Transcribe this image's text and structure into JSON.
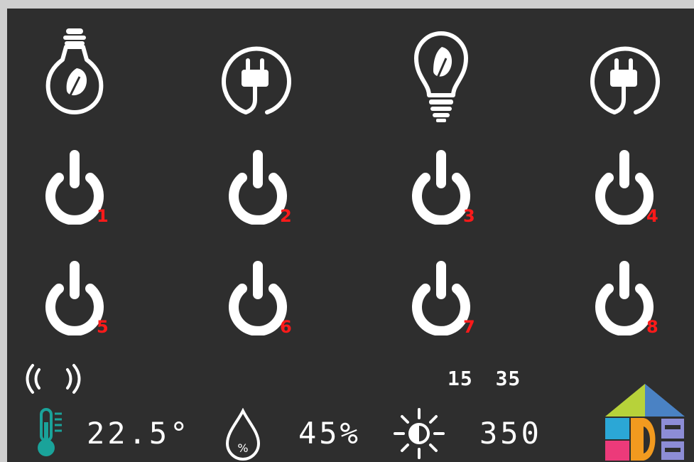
{
  "devices": [
    {
      "icon": "eco-bulb-icon"
    },
    {
      "icon": "plug-icon"
    },
    {
      "icon": "leaf-bulb-icon"
    },
    {
      "icon": "plug-icon"
    }
  ],
  "buttons": [
    {
      "label": "1"
    },
    {
      "label": "2"
    },
    {
      "label": "3"
    },
    {
      "label": "4"
    },
    {
      "label": "5"
    },
    {
      "label": "6"
    },
    {
      "label": "7"
    },
    {
      "label": "8"
    }
  ],
  "status": {
    "time": "15 35",
    "temperature": "22.5°",
    "humidity": "45%",
    "light": "350"
  },
  "colors": {
    "background": "#2e2e2e",
    "icon": "#ffffff",
    "button_number": "#ff1a1a",
    "thermometer": "#1aa39a"
  },
  "icons": {
    "signal": "wireless-signal-icon",
    "thermometer": "thermometer-icon",
    "humidity": "humidity-drop-icon",
    "light": "brightness-icon",
    "logo": "smart-home-logo-icon"
  }
}
